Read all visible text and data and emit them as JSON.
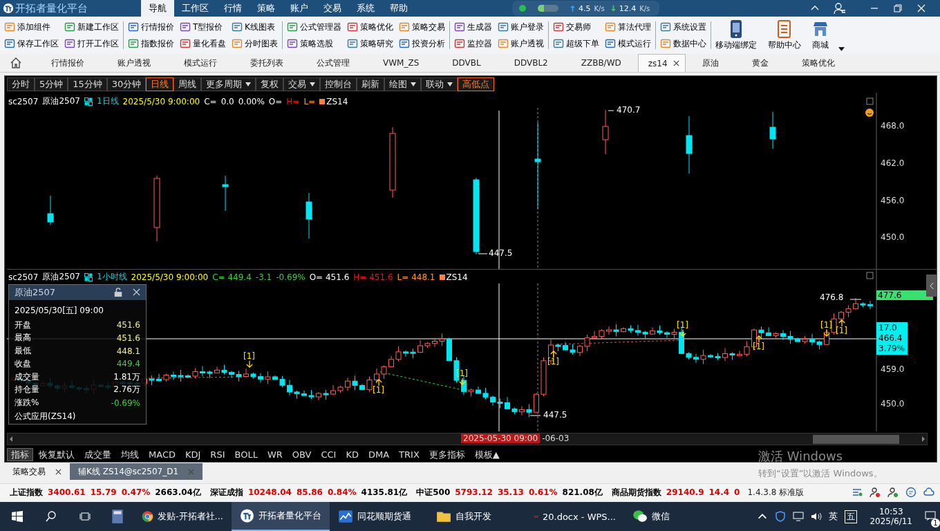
{
  "window": {
    "title": "开拓者量化平台",
    "menu": [
      {
        "label": "导航",
        "selected": true
      },
      {
        "label": "工作区",
        "selected": false
      },
      {
        "label": "行情",
        "selected": false
      },
      {
        "label": "策略",
        "selected": false
      },
      {
        "label": "账户",
        "selected": false
      },
      {
        "label": "交易",
        "selected": false
      },
      {
        "label": "系统",
        "selected": false
      },
      {
        "label": "帮助",
        "selected": false
      }
    ],
    "net": {
      "up": "4.5",
      "up_unit": "K/s",
      "down": "12.4",
      "down_unit": "K/s"
    }
  },
  "toolbar": {
    "groups": [
      [
        {
          "label": "添加组件"
        },
        {
          "label": "保存工作区"
        },
        {
          "label": "新建工作区"
        },
        {
          "label": "打开工作区"
        }
      ],
      [
        {
          "label": "行情报价"
        },
        {
          "label": "指数报价"
        },
        {
          "label": "T型报价"
        },
        {
          "label": "量化看盘"
        },
        {
          "label": "K线图表"
        },
        {
          "label": "分时图表"
        }
      ],
      [
        {
          "label": "公式管理器"
        },
        {
          "label": "策略选股"
        },
        {
          "label": "策略优化"
        },
        {
          "label": "策略研究"
        },
        {
          "label": "策略交易"
        },
        {
          "label": "投资分析"
        }
      ],
      [
        {
          "label": "生成器"
        },
        {
          "label": "监控器"
        },
        {
          "label": "账户登录"
        },
        {
          "label": "账户透视"
        }
      ],
      [
        {
          "label": "交易师"
        },
        {
          "label": "超级下单"
        },
        {
          "label": "算法代理"
        },
        {
          "label": "模式运行"
        }
      ],
      [
        {
          "label": "系统设置"
        },
        {
          "label": "数据中心"
        }
      ]
    ],
    "big": [
      {
        "label": "移动端绑定",
        "kind": "phone"
      },
      {
        "label": "帮助中心",
        "kind": "document"
      },
      {
        "label": "商城",
        "kind": "store"
      }
    ]
  },
  "tabs": [
    {
      "label": "行情报价",
      "selected": false,
      "closable": false
    },
    {
      "label": "账户透视",
      "selected": false,
      "closable": false
    },
    {
      "label": "模式运行",
      "selected": false,
      "closable": false
    },
    {
      "label": "委托列表",
      "selected": false,
      "closable": false
    },
    {
      "label": "公式管理",
      "selected": false,
      "closable": false
    },
    {
      "label": "VWM_ZS",
      "selected": false,
      "closable": false
    },
    {
      "label": "DDVBL",
      "selected": false,
      "closable": false
    },
    {
      "label": "DDVBL2",
      "selected": false,
      "closable": false
    },
    {
      "label": "ZZBB/WD",
      "selected": false,
      "closable": false
    },
    {
      "label": "zs14",
      "selected": true,
      "closable": true
    },
    {
      "label": "原油",
      "selected": false,
      "closable": false
    },
    {
      "label": "黄金",
      "selected": false,
      "closable": false
    },
    {
      "label": "策略优化",
      "selected": false,
      "closable": false
    }
  ],
  "chart": {
    "periods": [
      {
        "label": "分时",
        "selected": false,
        "dropdown": false
      },
      {
        "label": "5分钟",
        "selected": false,
        "dropdown": false
      },
      {
        "label": "15分钟",
        "selected": false,
        "dropdown": false
      },
      {
        "label": "30分钟",
        "selected": false,
        "dropdown": false
      },
      {
        "label": "日线",
        "selected": true,
        "dropdown": false
      },
      {
        "label": "周线",
        "selected": false,
        "dropdown": false
      },
      {
        "label": "更多周期",
        "selected": false,
        "dropdown": true
      },
      {
        "label": "复权",
        "selected": false,
        "dropdown": false
      },
      {
        "label": "交易",
        "selected": false,
        "dropdown": true
      },
      {
        "label": "控制台",
        "selected": false,
        "dropdown": false
      },
      {
        "label": "刷新",
        "selected": false,
        "dropdown": false
      },
      {
        "label": "绘图",
        "selected": false,
        "dropdown": true
      },
      {
        "label": "联动",
        "selected": false,
        "dropdown": true
      },
      {
        "label": "高低点",
        "selected": true,
        "dropdown": false
      }
    ],
    "upper": {
      "header": [
        {
          "kind": "text",
          "text": "sc2507",
          "color": "#ffffff"
        },
        {
          "kind": "text",
          "text": "原油2507",
          "color": "#ffffff"
        },
        {
          "kind": "icon"
        },
        {
          "kind": "text",
          "text": "1日线",
          "color": "#00d8e0"
        },
        {
          "kind": "text",
          "text": "2025/5/30 9:00:00",
          "color": "#ffff00"
        },
        {
          "kind": "text",
          "text": "C=",
          "color": "#ffffff"
        },
        {
          "kind": "text",
          "text": "0.0",
          "color": "#ffffff"
        },
        {
          "kind": "text",
          "text": "0.00%",
          "color": "#ffffff"
        },
        {
          "kind": "text",
          "text": "O=",
          "color": "#ffffff"
        },
        {
          "kind": "text",
          "text": "H=",
          "color": "#e01818"
        },
        {
          "kind": "text",
          "text": "L=",
          "color": "#ff9a1a"
        },
        {
          "kind": "legend",
          "text": "ZS14",
          "color": "#ff7f3f"
        }
      ],
      "axis": [
        "468.0",
        "462.0",
        "456.0",
        "450.0"
      ],
      "annotations": [
        "470.7",
        "447.5"
      ]
    },
    "lower": {
      "header": [
        {
          "kind": "text",
          "text": "sc2507",
          "color": "#ffffff"
        },
        {
          "kind": "text",
          "text": "原油2507",
          "color": "#ffffff"
        },
        {
          "kind": "icon"
        },
        {
          "kind": "text",
          "text": "1小时线",
          "color": "#00d8e0"
        },
        {
          "kind": "text",
          "text": "2025/5/30 9:00:00",
          "color": "#ffff00"
        },
        {
          "kind": "text",
          "text": "C= 449.4",
          "color": "#3ad03a"
        },
        {
          "kind": "text",
          "text": "-3.1",
          "color": "#3ad03a"
        },
        {
          "kind": "text",
          "text": "-0.69%",
          "color": "#3ad03a"
        },
        {
          "kind": "text",
          "text": "O= 451.6",
          "color": "#ffffff"
        },
        {
          "kind": "text",
          "text": "H= 451.6",
          "color": "#e01818"
        },
        {
          "kind": "text",
          "text": "L= 448.1",
          "color": "#ff9a1a"
        },
        {
          "kind": "legend",
          "text": "ZS14",
          "color": "#ff7f3f"
        }
      ],
      "axis": [
        "459.0",
        "450.0"
      ],
      "annotations": [
        "476.8",
        "447.5"
      ],
      "signals": [
        {
          "label": "[1]",
          "arrow_up": false
        },
        {
          "label": "[1]",
          "arrow_up": true
        },
        {
          "label": "[1]",
          "arrow_up": false
        },
        {
          "label": "[1]",
          "arrow_up": true
        },
        {
          "label": "[1]",
          "arrow_up": false
        },
        {
          "label": "[1]",
          "arrow_up": true
        },
        {
          "label": "[1]",
          "arrow_up": false
        },
        {
          "label": "[1]",
          "arrow_up": true
        }
      ],
      "last_price": "477.6",
      "cursor_box": [
        "17.0",
        "466.4",
        "3.79%"
      ]
    },
    "info_panel": {
      "title": "原油2507",
      "datetime": "2025/05/30[五] 09:00",
      "rows": [
        {
          "label": "开盘",
          "value": "451.6",
          "color": "#f0f080"
        },
        {
          "label": "最高",
          "value": "451.6",
          "color": "#f0f080"
        },
        {
          "label": "最低",
          "value": "448.1",
          "color": "#f0f080"
        },
        {
          "label": "收盘",
          "value": "449.4",
          "color": "#3ad03a"
        },
        {
          "label": "成交量",
          "value": "1.81万",
          "color": "#ffffff"
        },
        {
          "label": "持仓量",
          "value": "2.76万",
          "color": "#ffffff"
        },
        {
          "label": "涨跌%",
          "value": "-0.69%",
          "color": "#3ad03a"
        }
      ],
      "footer": "公式应用(ZS14)"
    },
    "cursor_time": "2025-05-30 09:00",
    "next_time": "-06-03",
    "indicators": [
      {
        "label": "指标",
        "selected": true
      },
      {
        "label": "恢复默认",
        "selected": false
      },
      {
        "label": "成交量",
        "selected": false
      },
      {
        "label": "均线",
        "selected": false
      },
      {
        "label": "MACD",
        "selected": false
      },
      {
        "label": "KDJ",
        "selected": false
      },
      {
        "label": "RSI",
        "selected": false
      },
      {
        "label": "BOLL",
        "selected": false
      },
      {
        "label": "WR",
        "selected": false
      },
      {
        "label": "OBV",
        "selected": false
      },
      {
        "label": "CCI",
        "selected": false
      },
      {
        "label": "KD",
        "selected": false
      },
      {
        "label": "DMA",
        "selected": false
      },
      {
        "label": "TRIX",
        "selected": false
      },
      {
        "label": "更多指标",
        "selected": false
      },
      {
        "label": "模板▲",
        "selected": false
      }
    ]
  },
  "activation_notice": {
    "title": "激活 Windows",
    "text": "转到“设置”以激活 Windows。"
  },
  "bottom_tabs": [
    {
      "label": "策略交易",
      "selected": false
    },
    {
      "label": "辅K线 ZS14@sc2507_D1",
      "selected": true
    }
  ],
  "index_bar": {
    "indices": [
      {
        "name": "上证指数",
        "values": [
          {
            "text": "3400.61",
            "color": "#e00000"
          },
          {
            "text": "15.79",
            "color": "#e00000"
          },
          {
            "text": "0.47%",
            "color": "#e00000"
          },
          {
            "text": "2663.04亿",
            "color": "#000000"
          }
        ]
      },
      {
        "name": "深证成指",
        "values": [
          {
            "text": "10248.04",
            "color": "#e00000"
          },
          {
            "text": "85.86",
            "color": "#e00000"
          },
          {
            "text": "0.84%",
            "color": "#e00000"
          },
          {
            "text": "4135.81亿",
            "color": "#000000"
          }
        ]
      },
      {
        "name": "中证500",
        "values": [
          {
            "text": "5793.12",
            "color": "#e00000"
          },
          {
            "text": "35.13",
            "color": "#e00000"
          },
          {
            "text": "0.61%",
            "color": "#e00000"
          },
          {
            "text": "821.08亿",
            "color": "#000000"
          }
        ]
      },
      {
        "name": "商品期货指数",
        "values": [
          {
            "text": "29140.9",
            "color": "#e00000"
          },
          {
            "text": "14.4",
            "color": "#e00000"
          },
          {
            "text": "0",
            "color": "#e00000"
          }
        ]
      }
    ],
    "version": "1.4.3.8 标准版"
  },
  "taskbar": {
    "apps": [
      {
        "kind": "calculator",
        "selected": false
      },
      {
        "label": "发贴-开拓者社...",
        "kind": "browser",
        "selected": false
      },
      {
        "label": "开拓者量化平台",
        "kind": "logo",
        "selected": true
      },
      {
        "label": "同花顺期货通",
        "kind": "chart",
        "selected": false
      },
      {
        "label": "自我开发",
        "kind": "folder",
        "selected": false
      },
      {
        "label": "20.docx - WPS...",
        "kind": "wps",
        "selected": false
      },
      {
        "label": "微信",
        "kind": "chat",
        "selected": false
      }
    ],
    "ime": [
      "英",
      "五"
    ],
    "time": "10:53",
    "date": "2025/6/11",
    "notifications": "1"
  }
}
